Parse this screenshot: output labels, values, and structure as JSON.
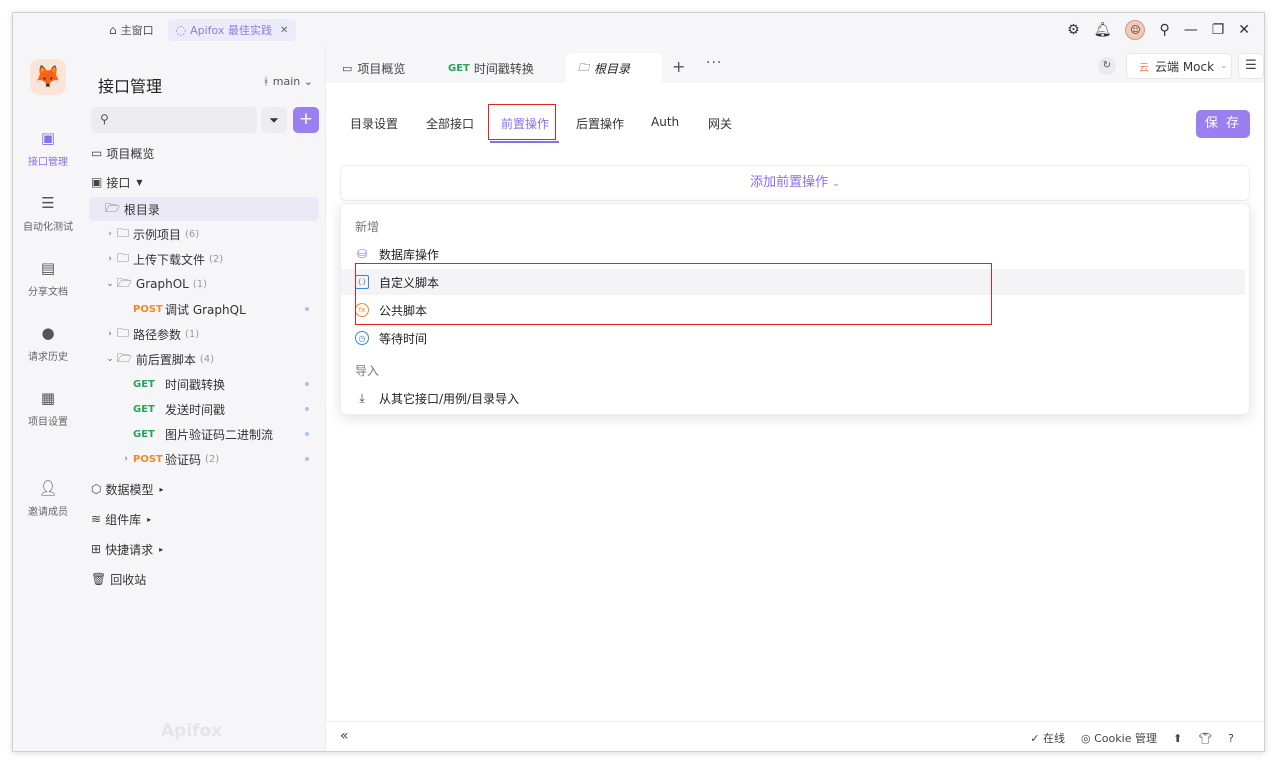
{
  "titlebar": {
    "home_tab": "主窗口",
    "project_tab": "Apifox 最佳实践",
    "close_icon": "✕"
  },
  "rail": {
    "items": [
      {
        "label": "接口管理",
        "icon": "api-icon"
      },
      {
        "label": "自动化测试",
        "icon": "automation-icon"
      },
      {
        "label": "分享文档",
        "icon": "share-doc-icon"
      },
      {
        "label": "请求历史",
        "icon": "history-icon"
      },
      {
        "label": "项目设置",
        "icon": "project-settings-icon"
      },
      {
        "label": "邀请成员",
        "icon": "invite-icon"
      }
    ]
  },
  "sidebar": {
    "title": "接口管理",
    "branch": "main",
    "search_placeholder": "",
    "tree": {
      "overview": "项目概览",
      "interfaces": "接口",
      "root": "根目录",
      "folder_examples": {
        "label": "示例项目",
        "count": "(6)"
      },
      "folder_upload": {
        "label": "上传下载文件",
        "count": "(2)"
      },
      "folder_graphql": {
        "label": "GraphOL",
        "count": "(1)"
      },
      "graphql_debug": {
        "method": "POST",
        "label": "调试 GraphQL"
      },
      "folder_path": {
        "label": "路径参数",
        "count": "(1)"
      },
      "folder_scripts": {
        "label": "前后置脚本",
        "count": "(4)"
      },
      "api_timestamp": {
        "method": "GET",
        "label": "时间戳转换"
      },
      "api_send_time": {
        "method": "GET",
        "label": "发送时间戳"
      },
      "api_captcha": {
        "method": "GET",
        "label": "图片验证码二进制流"
      },
      "api_verify": {
        "method": "POST",
        "label": "验证码",
        "count": "(2)"
      },
      "data_models": "数据模型",
      "components": "组件库",
      "quick_request": "快捷请求",
      "recycle_bin": "回收站"
    },
    "watermark": "Apifox"
  },
  "main": {
    "tabs": [
      {
        "label": "项目概览"
      },
      {
        "method": "GET",
        "label": "时间戳转换"
      },
      {
        "label": "根目录"
      }
    ],
    "mock_label": "云端 Mock",
    "mock_prefix": "云",
    "subtabs": [
      "目录设置",
      "全部接口",
      "前置操作",
      "后置操作",
      "Auth",
      "网关"
    ],
    "save_label": "保 存",
    "add_pre_label": "添加前置操作",
    "dropdown": {
      "group_new": "新增",
      "item_db": "数据库操作",
      "item_custom_script": "自定义脚本",
      "item_public_script": "公共脚本",
      "item_wait": "等待时间",
      "group_import": "导入",
      "item_import": "从其它接口/用例/目录导入"
    },
    "footer": {
      "online": "在线",
      "cookie": "Cookie 管理"
    }
  },
  "colors": {
    "accent": "#8b6fe8",
    "get": "#29a35a",
    "post": "#f08a24",
    "highlight": "#e02424"
  }
}
